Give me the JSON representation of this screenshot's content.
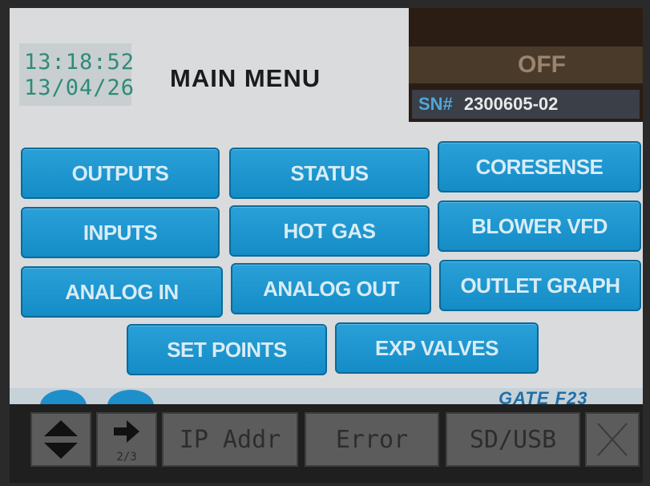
{
  "clock": {
    "time": "13:18:52",
    "date": "13/04/26"
  },
  "header": {
    "title": "MAIN MENU"
  },
  "status": {
    "state": "OFF",
    "serial_label": "SN#",
    "serial_number": "2300605-02"
  },
  "menu": {
    "outputs": "OUTPUTS",
    "status": "STATUS",
    "coresense": "CORESENSE",
    "inputs": "INPUTS",
    "hot_gas": "HOT GAS",
    "blower_vfd": "BLOWER VFD",
    "analog_in": "ANALOG IN",
    "analog_out": "ANALOG OUT",
    "outlet_graph": "OUTLET GRAPH",
    "set_points": "SET POINTS",
    "exp_valves": "EXP VALVES"
  },
  "footer": {
    "gate_label": "GATE F23"
  },
  "toolbar": {
    "page_indicator": "2/3",
    "ip_addr": "IP Addr",
    "error": "Error",
    "sd_usb": "SD/USB"
  },
  "colors": {
    "button_blue": "#1a94cf",
    "screen_bg": "#d9dbdd",
    "clock_green": "#2f8a7a",
    "toolbar_dark": "#1f1f1f"
  }
}
